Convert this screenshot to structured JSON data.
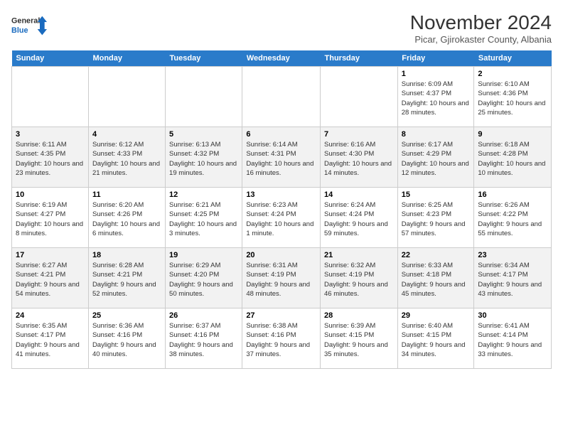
{
  "logo": {
    "line1": "General",
    "line2": "Blue"
  },
  "title": "November 2024",
  "subtitle": "Picar, Gjirokaster County, Albania",
  "weekdays": [
    "Sunday",
    "Monday",
    "Tuesday",
    "Wednesday",
    "Thursday",
    "Friday",
    "Saturday"
  ],
  "weeks": [
    [
      {
        "day": "",
        "info": ""
      },
      {
        "day": "",
        "info": ""
      },
      {
        "day": "",
        "info": ""
      },
      {
        "day": "",
        "info": ""
      },
      {
        "day": "",
        "info": ""
      },
      {
        "day": "1",
        "info": "Sunrise: 6:09 AM\nSunset: 4:37 PM\nDaylight: 10 hours and 28 minutes."
      },
      {
        "day": "2",
        "info": "Sunrise: 6:10 AM\nSunset: 4:36 PM\nDaylight: 10 hours and 25 minutes."
      }
    ],
    [
      {
        "day": "3",
        "info": "Sunrise: 6:11 AM\nSunset: 4:35 PM\nDaylight: 10 hours and 23 minutes."
      },
      {
        "day": "4",
        "info": "Sunrise: 6:12 AM\nSunset: 4:33 PM\nDaylight: 10 hours and 21 minutes."
      },
      {
        "day": "5",
        "info": "Sunrise: 6:13 AM\nSunset: 4:32 PM\nDaylight: 10 hours and 19 minutes."
      },
      {
        "day": "6",
        "info": "Sunrise: 6:14 AM\nSunset: 4:31 PM\nDaylight: 10 hours and 16 minutes."
      },
      {
        "day": "7",
        "info": "Sunrise: 6:16 AM\nSunset: 4:30 PM\nDaylight: 10 hours and 14 minutes."
      },
      {
        "day": "8",
        "info": "Sunrise: 6:17 AM\nSunset: 4:29 PM\nDaylight: 10 hours and 12 minutes."
      },
      {
        "day": "9",
        "info": "Sunrise: 6:18 AM\nSunset: 4:28 PM\nDaylight: 10 hours and 10 minutes."
      }
    ],
    [
      {
        "day": "10",
        "info": "Sunrise: 6:19 AM\nSunset: 4:27 PM\nDaylight: 10 hours and 8 minutes."
      },
      {
        "day": "11",
        "info": "Sunrise: 6:20 AM\nSunset: 4:26 PM\nDaylight: 10 hours and 6 minutes."
      },
      {
        "day": "12",
        "info": "Sunrise: 6:21 AM\nSunset: 4:25 PM\nDaylight: 10 hours and 3 minutes."
      },
      {
        "day": "13",
        "info": "Sunrise: 6:23 AM\nSunset: 4:24 PM\nDaylight: 10 hours and 1 minute."
      },
      {
        "day": "14",
        "info": "Sunrise: 6:24 AM\nSunset: 4:24 PM\nDaylight: 9 hours and 59 minutes."
      },
      {
        "day": "15",
        "info": "Sunrise: 6:25 AM\nSunset: 4:23 PM\nDaylight: 9 hours and 57 minutes."
      },
      {
        "day": "16",
        "info": "Sunrise: 6:26 AM\nSunset: 4:22 PM\nDaylight: 9 hours and 55 minutes."
      }
    ],
    [
      {
        "day": "17",
        "info": "Sunrise: 6:27 AM\nSunset: 4:21 PM\nDaylight: 9 hours and 54 minutes."
      },
      {
        "day": "18",
        "info": "Sunrise: 6:28 AM\nSunset: 4:21 PM\nDaylight: 9 hours and 52 minutes."
      },
      {
        "day": "19",
        "info": "Sunrise: 6:29 AM\nSunset: 4:20 PM\nDaylight: 9 hours and 50 minutes."
      },
      {
        "day": "20",
        "info": "Sunrise: 6:31 AM\nSunset: 4:19 PM\nDaylight: 9 hours and 48 minutes."
      },
      {
        "day": "21",
        "info": "Sunrise: 6:32 AM\nSunset: 4:19 PM\nDaylight: 9 hours and 46 minutes."
      },
      {
        "day": "22",
        "info": "Sunrise: 6:33 AM\nSunset: 4:18 PM\nDaylight: 9 hours and 45 minutes."
      },
      {
        "day": "23",
        "info": "Sunrise: 6:34 AM\nSunset: 4:17 PM\nDaylight: 9 hours and 43 minutes."
      }
    ],
    [
      {
        "day": "24",
        "info": "Sunrise: 6:35 AM\nSunset: 4:17 PM\nDaylight: 9 hours and 41 minutes."
      },
      {
        "day": "25",
        "info": "Sunrise: 6:36 AM\nSunset: 4:16 PM\nDaylight: 9 hours and 40 minutes."
      },
      {
        "day": "26",
        "info": "Sunrise: 6:37 AM\nSunset: 4:16 PM\nDaylight: 9 hours and 38 minutes."
      },
      {
        "day": "27",
        "info": "Sunrise: 6:38 AM\nSunset: 4:16 PM\nDaylight: 9 hours and 37 minutes."
      },
      {
        "day": "28",
        "info": "Sunrise: 6:39 AM\nSunset: 4:15 PM\nDaylight: 9 hours and 35 minutes."
      },
      {
        "day": "29",
        "info": "Sunrise: 6:40 AM\nSunset: 4:15 PM\nDaylight: 9 hours and 34 minutes."
      },
      {
        "day": "30",
        "info": "Sunrise: 6:41 AM\nSunset: 4:14 PM\nDaylight: 9 hours and 33 minutes."
      }
    ]
  ]
}
